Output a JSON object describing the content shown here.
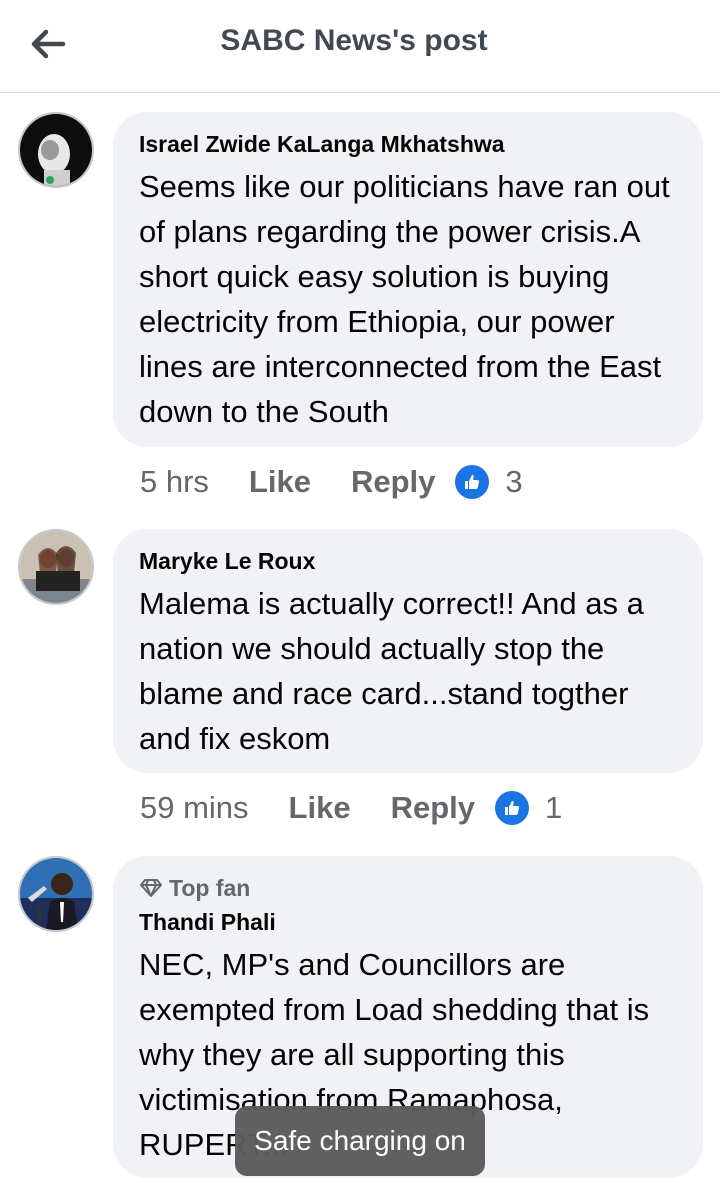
{
  "header": {
    "title": "SABC News's post",
    "back_icon": "arrow-left-icon"
  },
  "comments": [
    {
      "author": "Israel Zwide KaLanga Mkhatshwa",
      "text": "Seems like our politicians have ran out of plans regarding the power crisis.A short quick easy solution is buying electricity from  Ethiopia, our power lines are interconnected from the East down to the South",
      "time": "5 hrs",
      "like_label": "Like",
      "reply_label": "Reply",
      "reaction_count": "3"
    },
    {
      "author": "Maryke Le Roux",
      "text": "Malema is actually correct!! And as a nation we should actually stop the blame and race card...stand togther and fix eskom",
      "time": "59 mins",
      "like_label": "Like",
      "reply_label": "Reply",
      "reaction_count": "1"
    },
    {
      "badge": "Top fan",
      "author": "Thandi Phali",
      "text": "NEC, MP's and Councillors are exempted from Load shedding that is why they are all supporting this victimisation from Ramaphosa, RUPERT..."
    }
  ],
  "toast": {
    "text": "Safe charging on"
  },
  "colors": {
    "accent": "#1b74e4",
    "bubble": "#f0f2f5",
    "meta": "#65676b"
  }
}
